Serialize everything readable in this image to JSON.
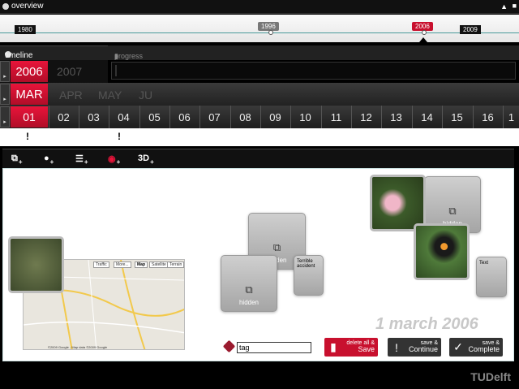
{
  "overview": {
    "title": "overview"
  },
  "years": {
    "start": "1980",
    "marker": "1996",
    "current": "2006",
    "end": "2009"
  },
  "timeline": {
    "title": "timeline",
    "year_selected": "2006",
    "year_next": "2007"
  },
  "progress": {
    "title": "progress"
  },
  "months": {
    "selected": "MAR",
    "next": [
      "APR",
      "MAY",
      "JU"
    ]
  },
  "days": [
    "01",
    "02",
    "03",
    "04",
    "05",
    "06",
    "07",
    "08",
    "09",
    "10",
    "11",
    "12",
    "13",
    "14",
    "15",
    "16",
    "1"
  ],
  "marks": [
    "!",
    "!"
  ],
  "toolbar": {
    "threed": "3D"
  },
  "cards": {
    "hidden1": "hidden",
    "hidden2": "hidden",
    "hidden3": "hidden",
    "accident_l1": "Terrible",
    "accident_l2": "accident",
    "text": "Text"
  },
  "date_label": "1 march 2006",
  "tag": {
    "value": "tag"
  },
  "buttons": {
    "delete_small": "delete all &",
    "delete_big": "Save",
    "continue_small": "save &",
    "continue_big": "Continue",
    "complete_small": "save &",
    "complete_big": "Complete"
  },
  "map": {
    "copyright": "©2009 Google - Map data ©2009 Google",
    "btn_traffic": "Traffic",
    "btn_more": "More...",
    "btn_map": "Map",
    "btn_sat": "Satellite",
    "btn_terrain": "Terrain"
  },
  "logo": "TUDelft",
  "colors": {
    "accent": "#c8102e",
    "bar": "#111111"
  }
}
